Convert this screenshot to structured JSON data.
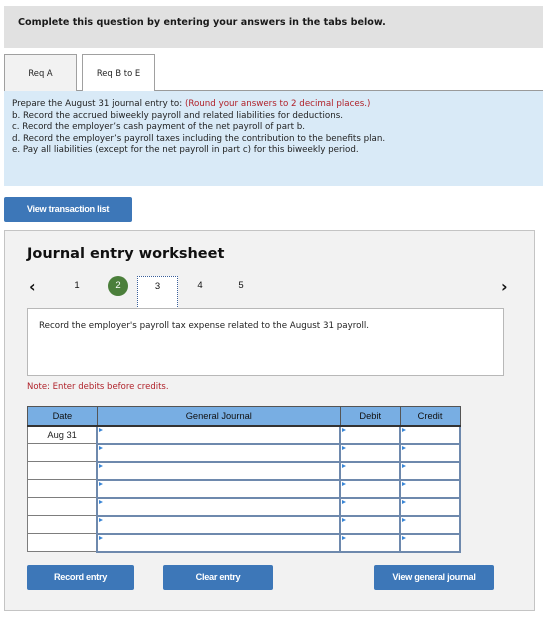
{
  "instructions": "Complete this question by entering your answers in the tabs below.",
  "tabs": [
    {
      "label": "Req A",
      "active": false
    },
    {
      "label": "Req B to E",
      "active": true
    }
  ],
  "prompt": {
    "intro": "Prepare the August 31 journal entry to: ",
    "hint": "(Round your answers to 2 decimal places.)",
    "items": [
      "b. Record the accrued biweekly payroll and related liabilities for deductions.",
      "c. Record the employer’s cash payment of the net payroll of part b.",
      "d. Record the employer’s payroll taxes including the contribution to the benefits plan.",
      "e. Pay all liabilities (except for the net payroll in part c) for this biweekly period."
    ]
  },
  "buttons": {
    "view_transaction_list": "View transaction list",
    "record_entry": "Record entry",
    "clear_entry": "Clear entry",
    "view_general_journal": "View general journal"
  },
  "worksheet": {
    "title": "Journal entry worksheet",
    "nav": {
      "prev": "‹",
      "next": "›"
    },
    "steps": [
      {
        "label": "1",
        "state": "default"
      },
      {
        "label": "2",
        "state": "completed"
      },
      {
        "label": "3",
        "state": "current"
      },
      {
        "label": "4",
        "state": "default"
      },
      {
        "label": "5",
        "state": "default"
      }
    ],
    "task": "Record the employer's payroll tax expense related to the August 31 payroll.",
    "note": "Note: Enter debits before credits."
  },
  "journal": {
    "headers": {
      "date": "Date",
      "general_journal": "General Journal",
      "debit": "Debit",
      "credit": "Credit"
    },
    "rows": [
      {
        "date": "Aug 31",
        "account": "",
        "debit": "",
        "credit": ""
      },
      {
        "date": "",
        "account": "",
        "debit": "",
        "credit": ""
      },
      {
        "date": "",
        "account": "",
        "debit": "",
        "credit": ""
      },
      {
        "date": "",
        "account": "",
        "debit": "",
        "credit": ""
      },
      {
        "date": "",
        "account": "",
        "debit": "",
        "credit": ""
      },
      {
        "date": "",
        "account": "",
        "debit": "",
        "credit": ""
      },
      {
        "date": "",
        "account": "",
        "debit": "",
        "credit": ""
      }
    ]
  },
  "colors": {
    "button": "#3d77b8",
    "header_blue": "#78aee3",
    "prompt_bg": "#d9eaf7",
    "hint_red": "#b0222a",
    "step_completed": "#4b7f3b"
  }
}
